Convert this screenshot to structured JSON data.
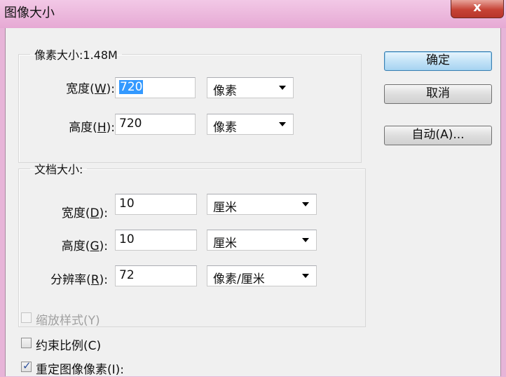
{
  "window": {
    "title": "图像大小",
    "close_glyph": "x"
  },
  "pixel_dimensions": {
    "legend": "像素大小:1.48M",
    "width": {
      "label_prefix": "宽度(",
      "accel": "W",
      "label_suffix": "):",
      "value": "720",
      "unit": "像素"
    },
    "height": {
      "label_prefix": "高度(",
      "accel": "H",
      "label_suffix": "):",
      "value": "720",
      "unit": "像素"
    }
  },
  "document_size": {
    "legend": "文档大小:",
    "width": {
      "label_prefix": "宽度(",
      "accel": "D",
      "label_suffix": "):",
      "value": "10",
      "unit": "厘米"
    },
    "height": {
      "label_prefix": "高度(",
      "accel": "G",
      "label_suffix": "):",
      "value": "10",
      "unit": "厘米"
    },
    "resolution": {
      "label_prefix": "分辨率(",
      "accel": "R",
      "label_suffix": "):",
      "value": "72",
      "unit": "像素/厘米"
    }
  },
  "buttons": {
    "ok": "确定",
    "cancel": "取消",
    "auto": "自动(A)..."
  },
  "checkboxes": {
    "scale_styles": {
      "label": "缩放样式(Y)",
      "checked": false,
      "enabled": false
    },
    "constrain_proportions": {
      "label": "约束比例(C)",
      "checked": false,
      "enabled": true
    },
    "resample": {
      "label": "重定图像像素(I):",
      "checked": true,
      "enabled": true,
      "check_glyph": "✓"
    }
  }
}
